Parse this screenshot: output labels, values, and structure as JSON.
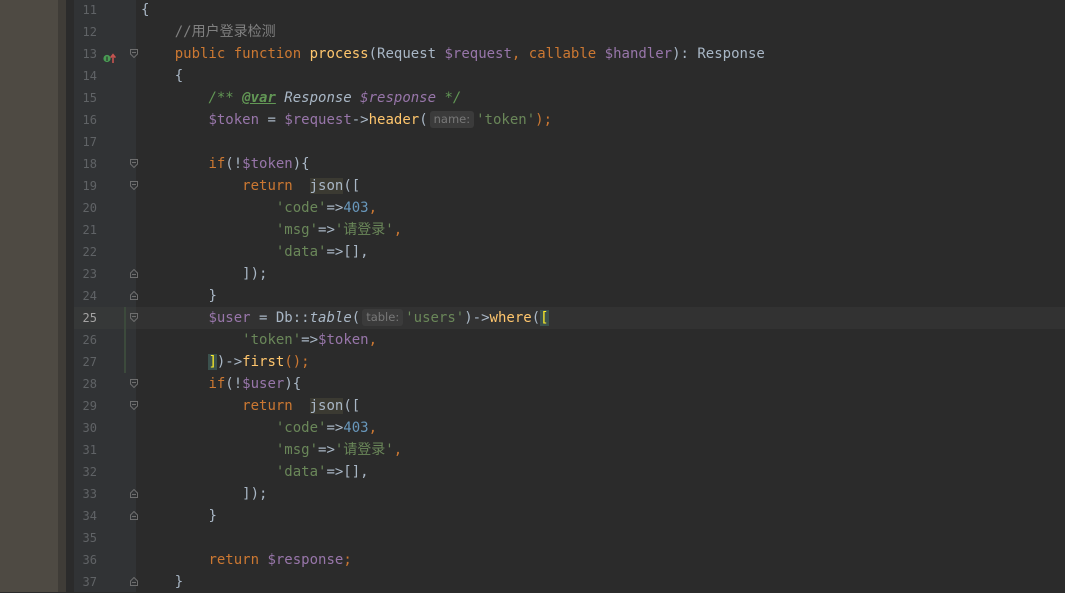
{
  "editor": {
    "language": "PHP",
    "current_line": "25",
    "lines": [
      {
        "n": "11"
      },
      {
        "n": "12"
      },
      {
        "n": "13"
      },
      {
        "n": "14"
      },
      {
        "n": "15"
      },
      {
        "n": "16"
      },
      {
        "n": "17"
      },
      {
        "n": "18"
      },
      {
        "n": "19"
      },
      {
        "n": "20"
      },
      {
        "n": "21"
      },
      {
        "n": "22"
      },
      {
        "n": "23"
      },
      {
        "n": "24"
      },
      {
        "n": "25"
      },
      {
        "n": "26"
      },
      {
        "n": "27"
      },
      {
        "n": "28"
      },
      {
        "n": "29"
      },
      {
        "n": "30"
      },
      {
        "n": "31"
      },
      {
        "n": "32"
      },
      {
        "n": "33"
      },
      {
        "n": "34"
      },
      {
        "n": "35"
      },
      {
        "n": "36"
      },
      {
        "n": "37"
      }
    ],
    "code": {
      "l11": "{",
      "l12_comment": "//用户登录检测",
      "l13_public": "public",
      "l13_function": "function",
      "l13_name": "process",
      "l13_paren_open": "(Request ",
      "l13_var1": "$request",
      "l13_comma": ", ",
      "l13_callable": "callable",
      "l13_var2": "$handler",
      "l13_tail": "): Response",
      "l14": "{",
      "l15_open": "/** ",
      "l15_tag": "@var",
      "l15_type": " Response ",
      "l15_var": "$response",
      "l15_close": " */",
      "l16_var": "$token",
      "l16_eq": " = ",
      "l16_req": "$request",
      "l16_arrow": "->",
      "l16_method": "header",
      "l16_open": "(",
      "l16_hint": "name:",
      "l16_str": "'token'",
      "l16_close": ");",
      "l18_if": "if",
      "l18_open": "(!",
      "l18_var": "$token",
      "l18_close": "){",
      "l19_return": "return",
      "l19_json": "json",
      "l19_open": "([",
      "l20_key": "'code'",
      "l20_arrow": "=>",
      "l20_val": "403",
      "l20_comma": ",",
      "l21_key": "'msg'",
      "l21_arrow": "=>",
      "l21_val": "'请登录'",
      "l21_comma": ",",
      "l22_key": "'data'",
      "l22_rest": "=>[],",
      "l23": "]);",
      "l24": "}",
      "l25_var": "$user",
      "l25_eq": " = Db::",
      "l25_table": "table",
      "l25_open": "(",
      "l25_hint": "table:",
      "l25_str": "'users'",
      "l25_close": ")->",
      "l25_where": "where",
      "l25_paren": "(",
      "l25_bracket": "[",
      "l26_key": "'token'",
      "l26_arrow": "=>",
      "l26_var": "$token",
      "l26_comma": ",",
      "l27_bracket": "]",
      "l27_mid": ")->",
      "l27_first": "first",
      "l27_end": "();",
      "l28_if": "if",
      "l28_open": "(!",
      "l28_var": "$user",
      "l28_close": "){",
      "l29_return": "return",
      "l29_json": "json",
      "l29_open": "([",
      "l30_key": "'code'",
      "l30_arrow": "=>",
      "l30_val": "403",
      "l30_comma": ",",
      "l31_key": "'msg'",
      "l31_arrow": "=>",
      "l31_val": "'请登录'",
      "l31_comma": ",",
      "l32_key": "'data'",
      "l32_rest": "=>[],",
      "l33": "]);",
      "l34": "}",
      "l36_return": "return",
      "l36_var": "$response",
      "l36_end": ";",
      "l37": "}"
    }
  },
  "icons": {
    "line13_marker": "implements-method-icon",
    "fold": "fold-marker-icon"
  },
  "colors": {
    "background": "#2b2b2b",
    "gutter": "#313335",
    "keyword": "#cc7832",
    "function": "#ffc66d",
    "variable": "#9876aa",
    "string": "#6a8759",
    "number": "#6897bb",
    "comment": "#808080"
  }
}
